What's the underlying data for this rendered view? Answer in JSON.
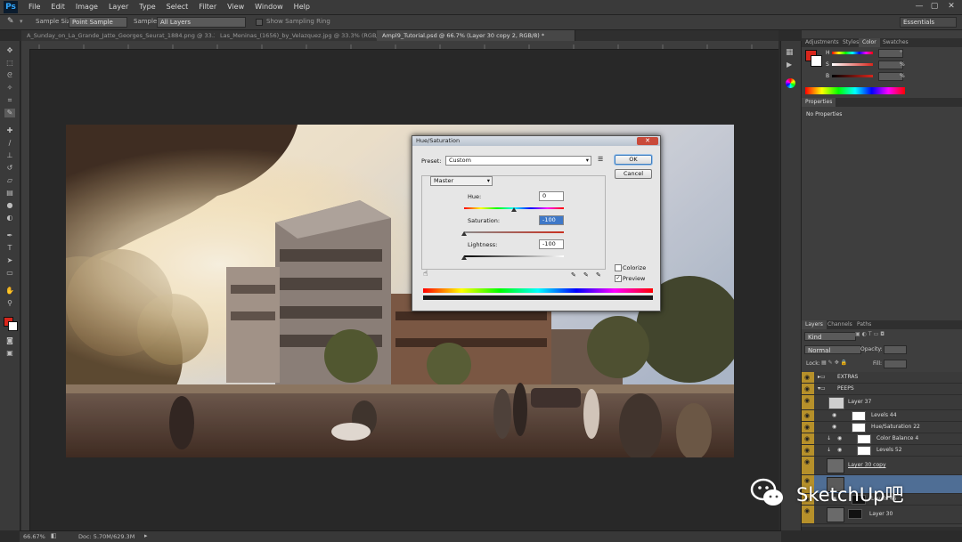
{
  "app": {
    "logo": "Ps",
    "window_controls": [
      "—",
      "▢",
      "✕"
    ]
  },
  "menu": [
    "File",
    "Edit",
    "Image",
    "Layer",
    "Type",
    "Select",
    "Filter",
    "View",
    "Window",
    "Help"
  ],
  "options": {
    "sample_size_label": "Sample Size:",
    "sample_size_value": "Point Sample",
    "sample_label": "Sample:",
    "sample_value": "All Layers",
    "show_ring": "Show Sampling Ring",
    "workspace": "Essentials"
  },
  "tabs": [
    {
      "label": "A_Sunday_on_La_Grande_Jatte_Georges_Seurat_1884.png @ 33.3% (RGB/8)"
    },
    {
      "label": "Las_Meninas_(1656)_by_Velazquez.jpg @ 33.3% (RGB/8)"
    },
    {
      "label": "Ampl9_Tutorial.psd @ 66.7% (Layer 30 copy 2, RGB/8) *"
    }
  ],
  "dialog": {
    "title": "Hue/Saturation",
    "preset_label": "Preset:",
    "preset_value": "Custom",
    "channel": "Master",
    "hue_label": "Hue:",
    "hue_value": "0",
    "saturation_label": "Saturation:",
    "saturation_value": "-100",
    "lightness_label": "Lightness:",
    "lightness_value": "-100",
    "ok": "OK",
    "cancel": "Cancel",
    "colorize": "Colorize",
    "preview": "Preview",
    "preview_checked": "✓",
    "close": "✕"
  },
  "color_panel": {
    "tabs": [
      "Adjustments",
      "Styles",
      "Color",
      "Swatches"
    ],
    "channels": [
      "H",
      "S",
      "B"
    ],
    "units": [
      "°",
      "%",
      "%"
    ],
    "fg_color": "#d8261c"
  },
  "properties": {
    "tab": "Properties",
    "text": "No Properties"
  },
  "layers_panel": {
    "tabs": [
      "Layers",
      "Channels",
      "Paths"
    ],
    "kind": "Kind",
    "blend": "Normal",
    "opacity_label": "Opacity:",
    "lock_label": "Lock:",
    "fill_label": "Fill:",
    "layers": [
      {
        "name": "EXTRAS",
        "type": "group"
      },
      {
        "name": "PEEPS",
        "type": "group"
      },
      {
        "name": "Layer 37",
        "type": "pixel"
      },
      {
        "name": "Levels 44",
        "type": "adjust"
      },
      {
        "name": "Hue/Saturation 22",
        "type": "adjust"
      },
      {
        "name": "Color Balance 4",
        "type": "adjust"
      },
      {
        "name": "Levels 52",
        "type": "adjust"
      },
      {
        "name": "Layer 30 copy",
        "type": "pixel"
      },
      {
        "name": "",
        "type": "pixel"
      },
      {
        "name": "Levels 45",
        "type": "adjust"
      },
      {
        "name": "Layer 30",
        "type": "pixel"
      }
    ]
  },
  "status": {
    "zoom": "66.67%",
    "doc": "Doc: 5.70M/629.3M"
  },
  "watermark": {
    "text": "SketchUp吧"
  }
}
